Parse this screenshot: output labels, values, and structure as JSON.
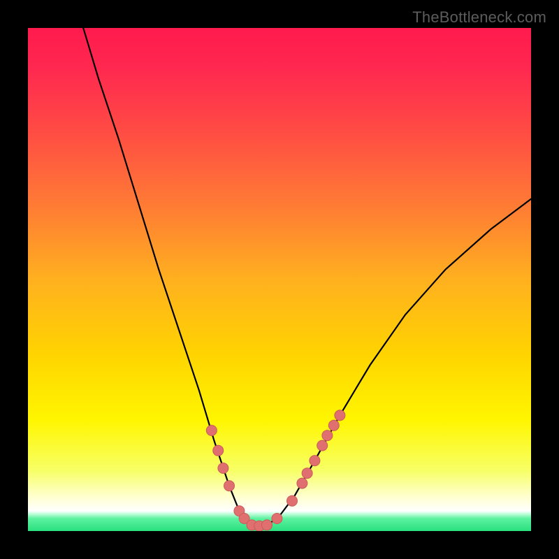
{
  "watermark": "TheBottleneck.com",
  "colors": {
    "frame_bg": "#000000",
    "curve": "#000000",
    "marker_fill": "#e07070",
    "marker_stroke": "#cc5a5a",
    "bottom_band": "#29e07e",
    "gradient_stops": [
      {
        "offset": 0.0,
        "color": "#ff1a4d"
      },
      {
        "offset": 0.08,
        "color": "#ff2850"
      },
      {
        "offset": 0.2,
        "color": "#ff4a44"
      },
      {
        "offset": 0.35,
        "color": "#ff7a35"
      },
      {
        "offset": 0.5,
        "color": "#ffb01f"
      },
      {
        "offset": 0.65,
        "color": "#ffd400"
      },
      {
        "offset": 0.78,
        "color": "#fff600"
      },
      {
        "offset": 0.88,
        "color": "#f7ff66"
      },
      {
        "offset": 0.93,
        "color": "#ffffcc"
      },
      {
        "offset": 0.96,
        "color": "#ffffff"
      },
      {
        "offset": 0.965,
        "color": "#c9ffe0"
      },
      {
        "offset": 0.975,
        "color": "#5df2a0"
      },
      {
        "offset": 1.0,
        "color": "#29e07e"
      }
    ]
  },
  "chart_data": {
    "type": "line",
    "title": "",
    "xlabel": "",
    "ylabel": "",
    "xlim": [
      0,
      100
    ],
    "ylim": [
      0,
      100
    ],
    "curve_description": "V-shaped bottleneck curve: steep descent from top-left, trough near x≈45 at y≈0, then rises toward top-right at shallower angle.",
    "curve_points": [
      {
        "x": 11.0,
        "y": 100.0
      },
      {
        "x": 14.0,
        "y": 90.0
      },
      {
        "x": 18.0,
        "y": 78.0
      },
      {
        "x": 22.0,
        "y": 65.0
      },
      {
        "x": 26.0,
        "y": 52.0
      },
      {
        "x": 30.0,
        "y": 40.0
      },
      {
        "x": 34.0,
        "y": 28.0
      },
      {
        "x": 37.0,
        "y": 18.0
      },
      {
        "x": 40.0,
        "y": 9.0
      },
      {
        "x": 42.0,
        "y": 4.0
      },
      {
        "x": 44.0,
        "y": 1.5
      },
      {
        "x": 46.0,
        "y": 1.0
      },
      {
        "x": 48.0,
        "y": 1.5
      },
      {
        "x": 50.0,
        "y": 3.0
      },
      {
        "x": 53.0,
        "y": 7.0
      },
      {
        "x": 57.0,
        "y": 14.0
      },
      {
        "x": 62.0,
        "y": 23.0
      },
      {
        "x": 68.0,
        "y": 33.0
      },
      {
        "x": 75.0,
        "y": 43.0
      },
      {
        "x": 83.0,
        "y": 52.0
      },
      {
        "x": 92.0,
        "y": 60.0
      },
      {
        "x": 100.0,
        "y": 66.0
      }
    ],
    "markers": [
      {
        "x": 36.5,
        "y": 20.0
      },
      {
        "x": 37.8,
        "y": 16.0
      },
      {
        "x": 38.8,
        "y": 12.5
      },
      {
        "x": 40.0,
        "y": 9.0
      },
      {
        "x": 42.0,
        "y": 4.0
      },
      {
        "x": 43.0,
        "y": 2.5
      },
      {
        "x": 44.5,
        "y": 1.2
      },
      {
        "x": 46.0,
        "y": 1.0
      },
      {
        "x": 47.5,
        "y": 1.2
      },
      {
        "x": 49.5,
        "y": 2.5
      },
      {
        "x": 52.5,
        "y": 6.0
      },
      {
        "x": 54.5,
        "y": 9.5
      },
      {
        "x": 55.5,
        "y": 11.5
      },
      {
        "x": 57.0,
        "y": 14.0
      },
      {
        "x": 58.5,
        "y": 17.0
      },
      {
        "x": 59.5,
        "y": 19.0
      },
      {
        "x": 60.8,
        "y": 21.0
      },
      {
        "x": 62.0,
        "y": 23.0
      }
    ]
  }
}
